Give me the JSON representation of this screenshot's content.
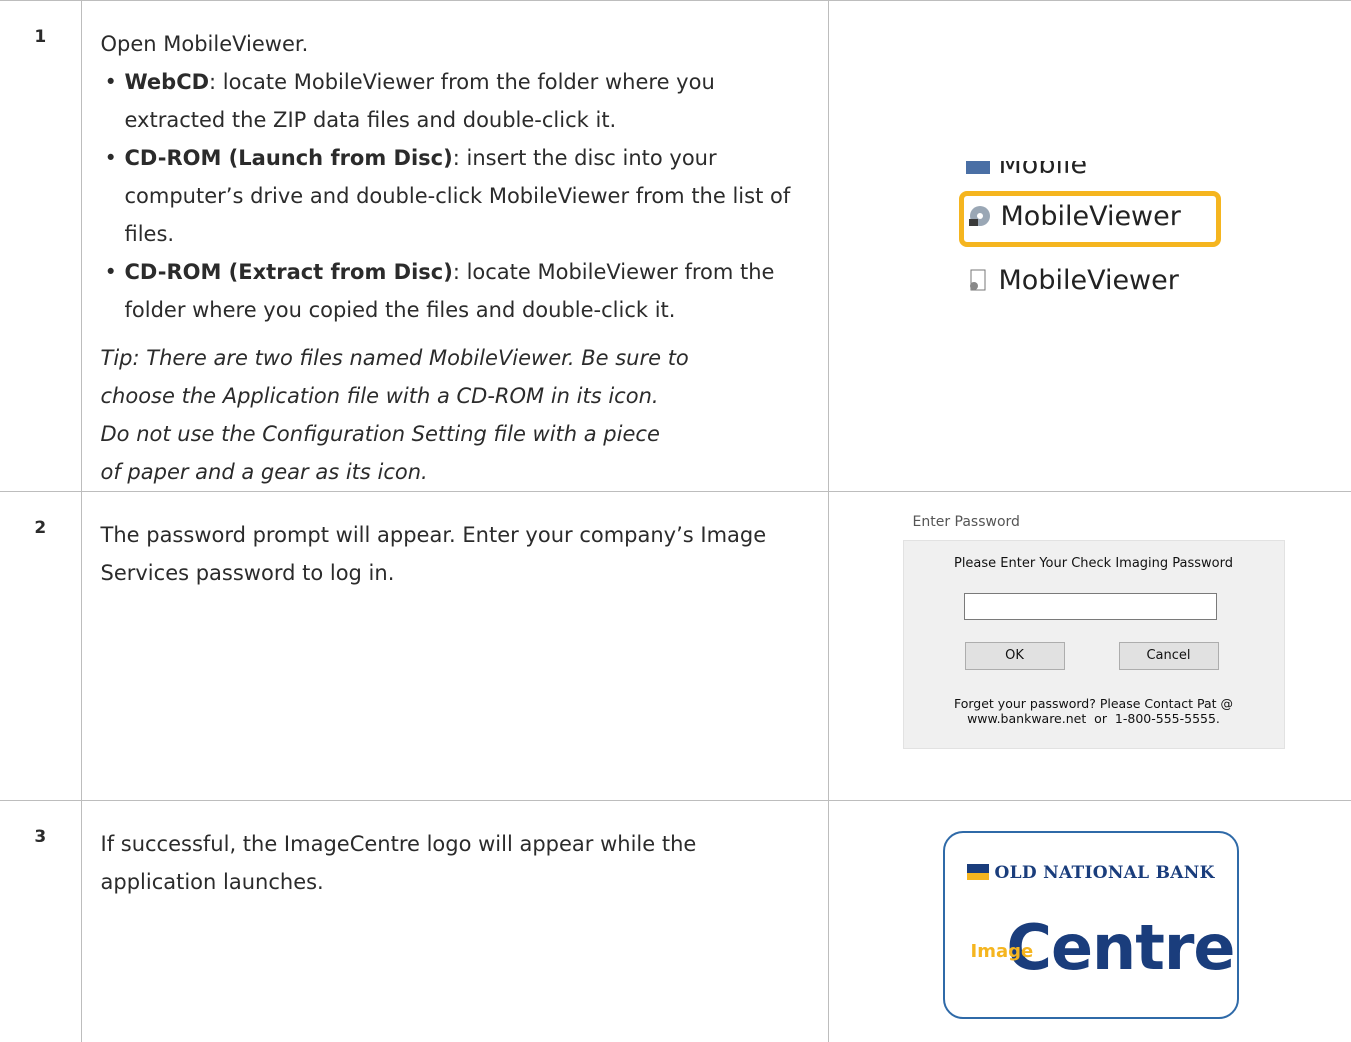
{
  "steps": [
    {
      "number": "1",
      "intro": "Open MobileViewer.",
      "bullets": [
        {
          "term": "WebCD",
          "text": ": locate MobileViewer from the folder where you extracted the ZIP data files and double-click it."
        },
        {
          "term": "CD-ROM (Launch from Disc)",
          "text": ": insert the disc into your computer’s drive and double-click MobileViewer from the list of files."
        },
        {
          "term": "CD-ROM (Extract from Disc)",
          "text": ": locate MobileViewer from the folder where you copied the files and double-click it."
        }
      ],
      "tip_lines": [
        "Tip: There are two files named MobileViewer. Be sure to",
        "choose the Application file with a CD-ROM in its icon.",
        "Do not use the Configuration Setting file with a piece",
        "of paper and a gear as its icon."
      ],
      "image": {
        "files": [
          "Mobile",
          "MobileViewer",
          "MobileViewer"
        ],
        "highlight_color": "#f5b51f"
      }
    },
    {
      "number": "2",
      "text": "The password prompt will appear. Enter your company’s Image Services password to log in.",
      "image": {
        "window_title": "Enter Password",
        "prompt": "Please Enter Your Check Imaging Password",
        "ok_label": "OK",
        "cancel_label": "Cancel",
        "forgot_line1": "Forget your password? Please Contact Pat @",
        "forgot_line2": "www.bankware.net  or  1-800-555-5555."
      }
    },
    {
      "number": "3",
      "text": "If successful, the ImageCentre logo will appear while the application launches.",
      "image": {
        "bank_name": "OLD NATIONAL BANK",
        "image_word": "Image",
        "centre_word": "Centre",
        "brand_blue": "#1a3d7c",
        "brand_gold": "#f5b51f"
      }
    }
  ]
}
